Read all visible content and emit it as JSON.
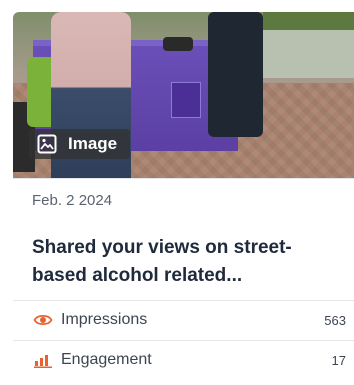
{
  "post": {
    "media_badge_label": "Image",
    "date": "Feb. 2 2024",
    "title_line1": "Shared your views on street-",
    "title_line2": "based alcohol related..."
  },
  "metrics": [
    {
      "label": "Impressions",
      "value": "563",
      "icon": "eye-icon"
    },
    {
      "label": "Engagement",
      "value": "17",
      "icon": "bar-chart-icon"
    }
  ],
  "colors": {
    "metric_icon": "#e8622f",
    "title": "#1f2a3c",
    "text": "#3c4652",
    "badge_bg": "#333333"
  }
}
